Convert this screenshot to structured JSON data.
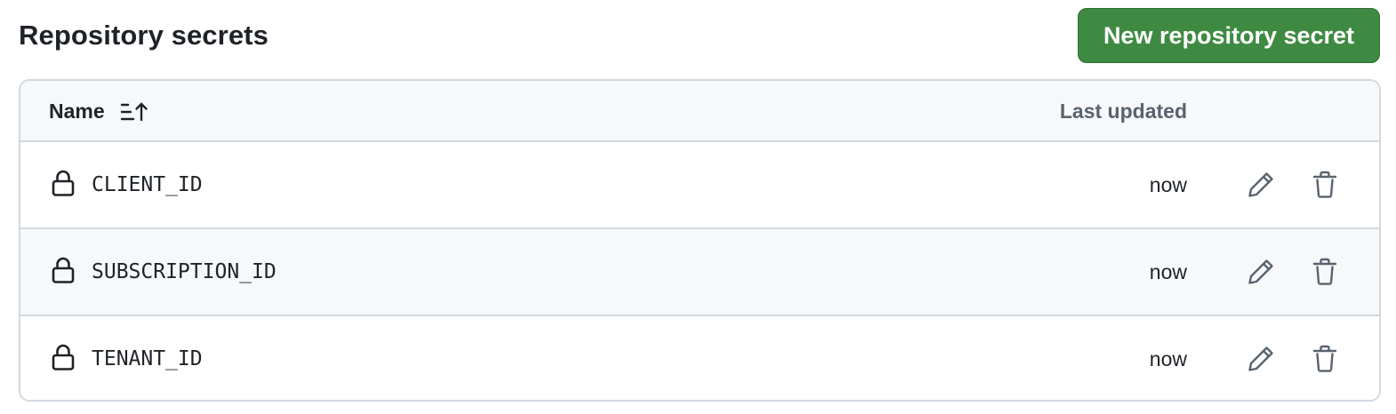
{
  "header": {
    "title": "Repository secrets",
    "new_button_label": "New repository secret"
  },
  "colors": {
    "primary_button": "#3f8a42",
    "border": "#d1d9e0",
    "header_bg": "#f6f8fa",
    "muted_text": "#59636e",
    "icon": "#59636e"
  },
  "table": {
    "columns": {
      "name": "Name",
      "last_updated": "Last updated"
    },
    "sort_icon": "sort-ascending-icon",
    "rows": [
      {
        "name": "CLIENT_ID",
        "last_updated": "now",
        "icon": "lock-icon"
      },
      {
        "name": "SUBSCRIPTION_ID",
        "last_updated": "now",
        "icon": "lock-icon"
      },
      {
        "name": "TENANT_ID",
        "last_updated": "now",
        "icon": "lock-icon"
      }
    ],
    "row_actions": [
      "pencil-icon",
      "trash-icon"
    ]
  }
}
